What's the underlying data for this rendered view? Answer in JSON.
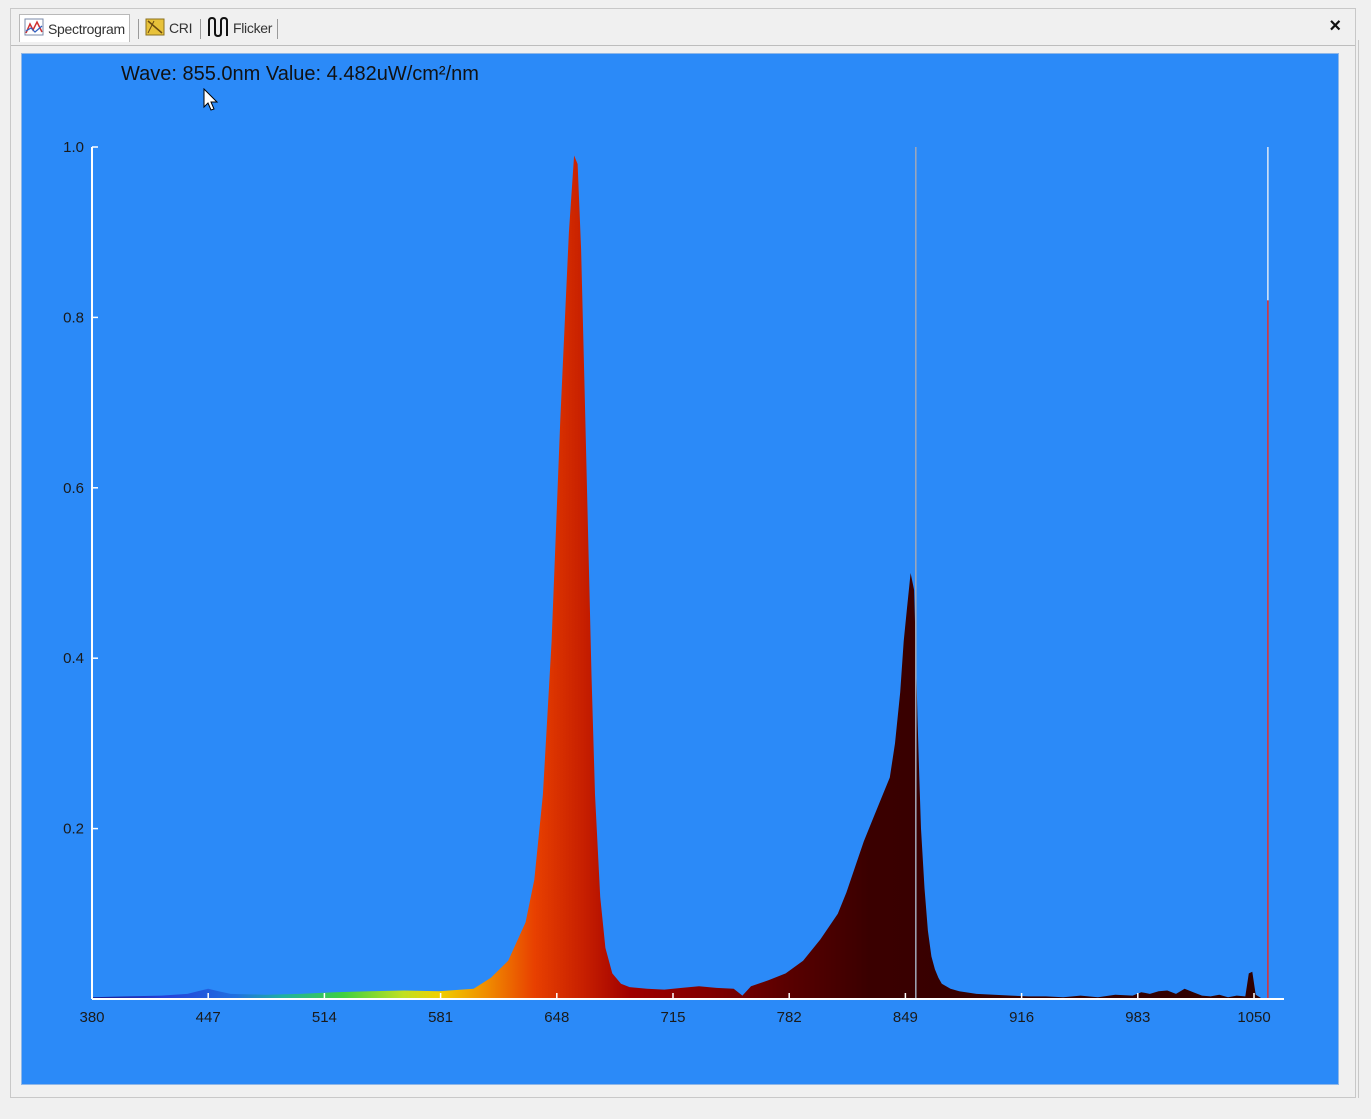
{
  "tabs": [
    {
      "label": "Spectrogram",
      "icon": "spectrogram-icon",
      "active": true
    },
    {
      "label": "CRI",
      "icon": "cri-icon",
      "active": false
    },
    {
      "label": "Flicker",
      "icon": "flicker-icon",
      "active": false
    }
  ],
  "close_label": "×",
  "readout": "Wave: 855.0nm Value: 4.482uW/cm²/nm",
  "colors": {
    "plot_background": "#2b8af8",
    "axis": "#ffffff",
    "cursor_line": "#a0a8b8",
    "marker_line": "#e03030"
  },
  "chart_data": {
    "type": "area",
    "xlabel": "",
    "ylabel": "",
    "xlim": [
      380,
      1065
    ],
    "ylim": [
      0,
      1.0
    ],
    "x_ticks": [
      380,
      447,
      514,
      581,
      648,
      715,
      782,
      849,
      916,
      983,
      1050
    ],
    "y_ticks": [
      0.2,
      0.4,
      0.6,
      0.8,
      1.0
    ],
    "y_tick_labels": [
      "0.2",
      "0.4",
      "0.6",
      "0.8",
      "1.0"
    ],
    "cursor_wavelength": 855.0,
    "marker_wavelength": 1058,
    "series": [
      {
        "x": [
          380,
          400,
          420,
          435,
          441,
          447,
          453,
          460,
          480,
          500,
          520,
          540,
          560,
          580,
          600,
          610,
          620,
          630,
          635,
          640,
          645,
          650,
          655,
          658,
          660,
          662,
          664,
          666,
          668,
          670,
          673,
          676,
          680,
          685,
          690,
          700,
          710,
          720,
          730,
          740,
          750,
          755,
          760,
          770,
          780,
          790,
          800,
          810,
          815,
          820,
          825,
          830,
          835,
          840,
          843,
          846,
          848,
          850,
          852,
          854,
          855,
          856,
          857,
          858,
          860,
          862,
          864,
          866,
          868,
          870,
          875,
          880,
          890,
          900,
          910,
          920,
          930,
          940,
          950,
          960,
          970,
          980,
          985,
          990,
          995,
          1000,
          1005,
          1010,
          1015,
          1020,
          1025,
          1030,
          1035,
          1040,
          1045,
          1047,
          1049,
          1051,
          1055
        ],
        "y": [
          0.002,
          0.003,
          0.004,
          0.006,
          0.009,
          0.012,
          0.009,
          0.006,
          0.005,
          0.006,
          0.008,
          0.009,
          0.01,
          0.009,
          0.012,
          0.025,
          0.045,
          0.09,
          0.14,
          0.24,
          0.42,
          0.68,
          0.9,
          0.99,
          0.98,
          0.88,
          0.72,
          0.55,
          0.38,
          0.24,
          0.12,
          0.06,
          0.03,
          0.018,
          0.014,
          0.012,
          0.011,
          0.013,
          0.015,
          0.013,
          0.012,
          0.004,
          0.015,
          0.022,
          0.03,
          0.045,
          0.07,
          0.1,
          0.125,
          0.155,
          0.185,
          0.21,
          0.235,
          0.26,
          0.3,
          0.36,
          0.42,
          0.46,
          0.5,
          0.48,
          0.41,
          0.33,
          0.26,
          0.2,
          0.13,
          0.08,
          0.05,
          0.035,
          0.025,
          0.018,
          0.012,
          0.009,
          0.006,
          0.005,
          0.004,
          0.003,
          0.003,
          0.002,
          0.004,
          0.002,
          0.005,
          0.004,
          0.008,
          0.006,
          0.009,
          0.01,
          0.006,
          0.012,
          0.008,
          0.004,
          0.003,
          0.005,
          0.002,
          0.004,
          0.003,
          0.03,
          0.032,
          0.005,
          0.0
        ]
      }
    ]
  }
}
